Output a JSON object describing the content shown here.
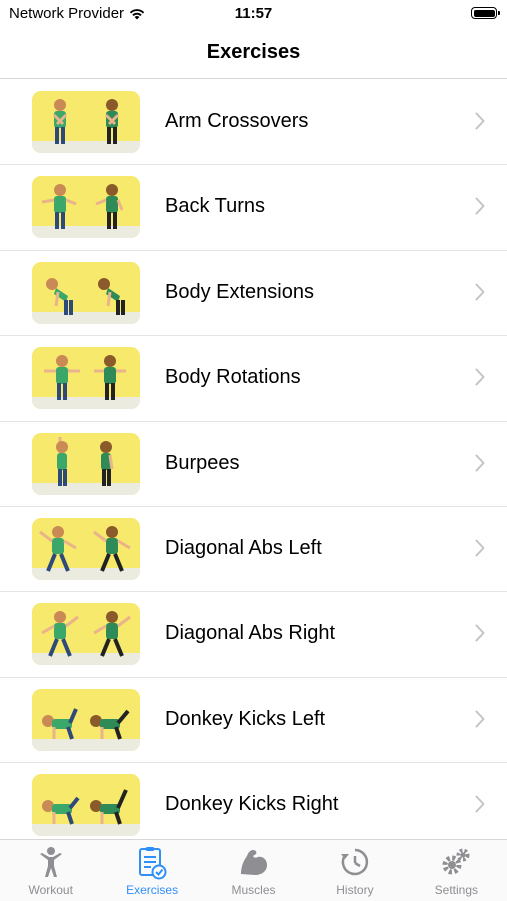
{
  "status_bar": {
    "carrier": "Network Provider",
    "time": "11:57",
    "wifi_icon": "wifi-icon",
    "battery_icon": "battery-icon"
  },
  "nav": {
    "title": "Exercises"
  },
  "exercises": [
    {
      "name": "Arm Crossovers"
    },
    {
      "name": "Back Turns"
    },
    {
      "name": "Body Extensions"
    },
    {
      "name": "Body Rotations"
    },
    {
      "name": "Burpees"
    },
    {
      "name": "Diagonal Abs Left"
    },
    {
      "name": "Diagonal Abs Right"
    },
    {
      "name": "Donkey Kicks Left"
    },
    {
      "name": "Donkey Kicks Right"
    }
  ],
  "tabs": [
    {
      "label": "Workout",
      "icon": "person-icon",
      "active": false
    },
    {
      "label": "Exercises",
      "icon": "exercise-list-icon",
      "active": true
    },
    {
      "label": "Muscles",
      "icon": "bicep-icon",
      "active": false
    },
    {
      "label": "History",
      "icon": "history-icon",
      "active": false
    },
    {
      "label": "Settings",
      "icon": "gears-icon",
      "active": false
    }
  ],
  "colors": {
    "accent": "#2f8ff7",
    "inactive": "#8e8e93",
    "thumbnail_background": "#f7e96b"
  }
}
